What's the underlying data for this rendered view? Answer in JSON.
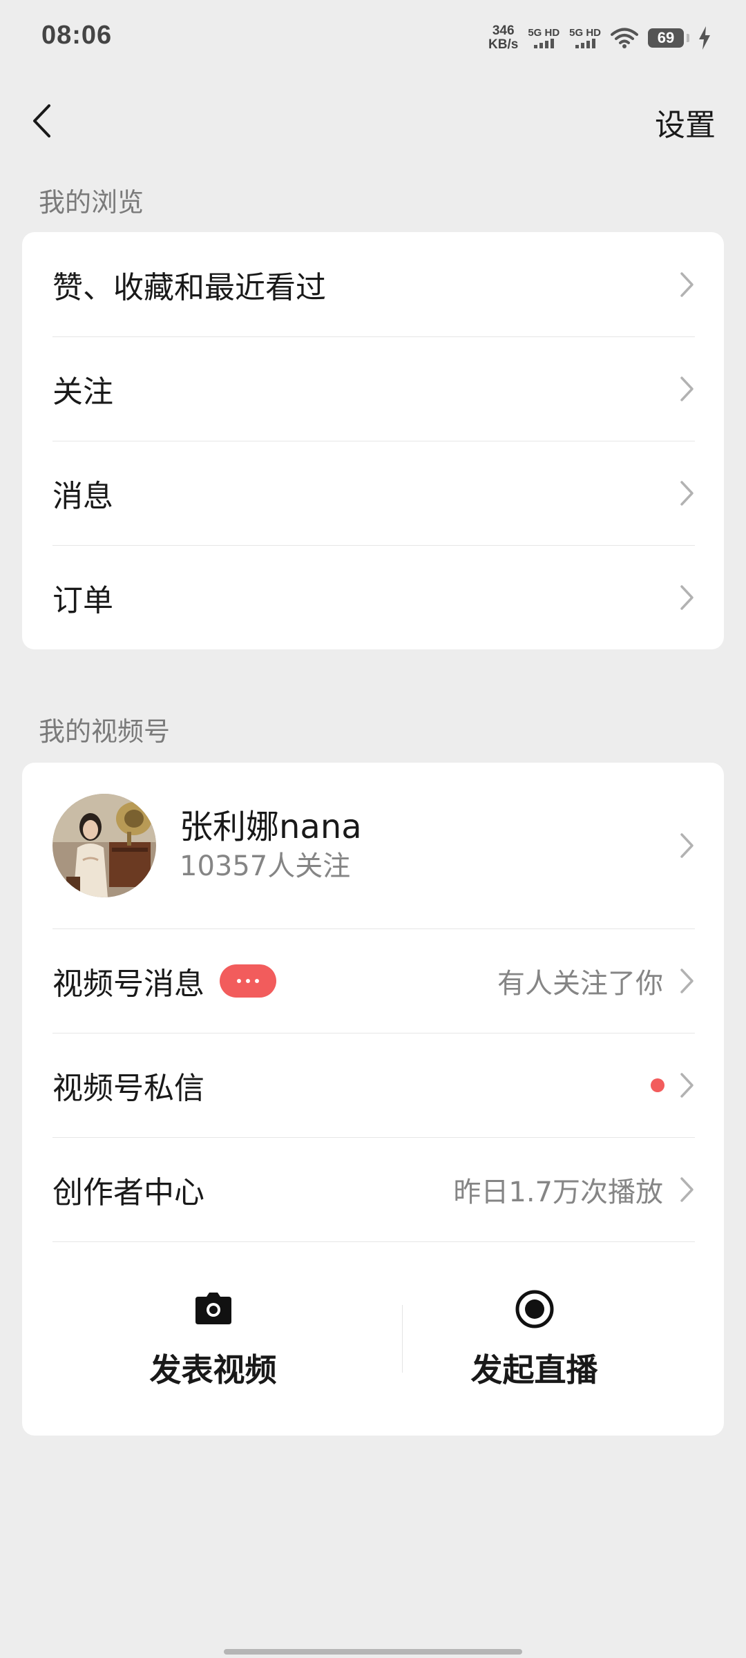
{
  "status_bar": {
    "time": "08:06",
    "net_speed_value": "346",
    "net_speed_unit": "KB/s",
    "sim1_label": "5G HD",
    "sim2_label": "5G HD",
    "battery_level": "69"
  },
  "nav": {
    "back_icon": "chevron-left-icon",
    "settings_label": "设置"
  },
  "browse_section": {
    "title": "我的浏览",
    "items": [
      {
        "label": "赞、收藏和最近看过"
      },
      {
        "label": "关注"
      },
      {
        "label": "消息"
      },
      {
        "label": "订单"
      }
    ]
  },
  "channels_section": {
    "title": "我的视频号",
    "profile": {
      "name": "张利娜nana",
      "followers": "10357人关注"
    },
    "items": [
      {
        "label": "视频号消息",
        "detail": "有人关注了你",
        "badge": "dots"
      },
      {
        "label": "视频号私信",
        "detail": "",
        "badge": "dot"
      },
      {
        "label": "创作者中心",
        "detail": "昨日1.7万次播放"
      }
    ],
    "actions": [
      {
        "label": "发表视频",
        "icon": "camera-icon"
      },
      {
        "label": "发起直播",
        "icon": "live-record-icon"
      }
    ]
  },
  "colors": {
    "background": "#ededed",
    "card": "#ffffff",
    "badge_red": "#f25c5c",
    "secondary_text": "#858585"
  }
}
